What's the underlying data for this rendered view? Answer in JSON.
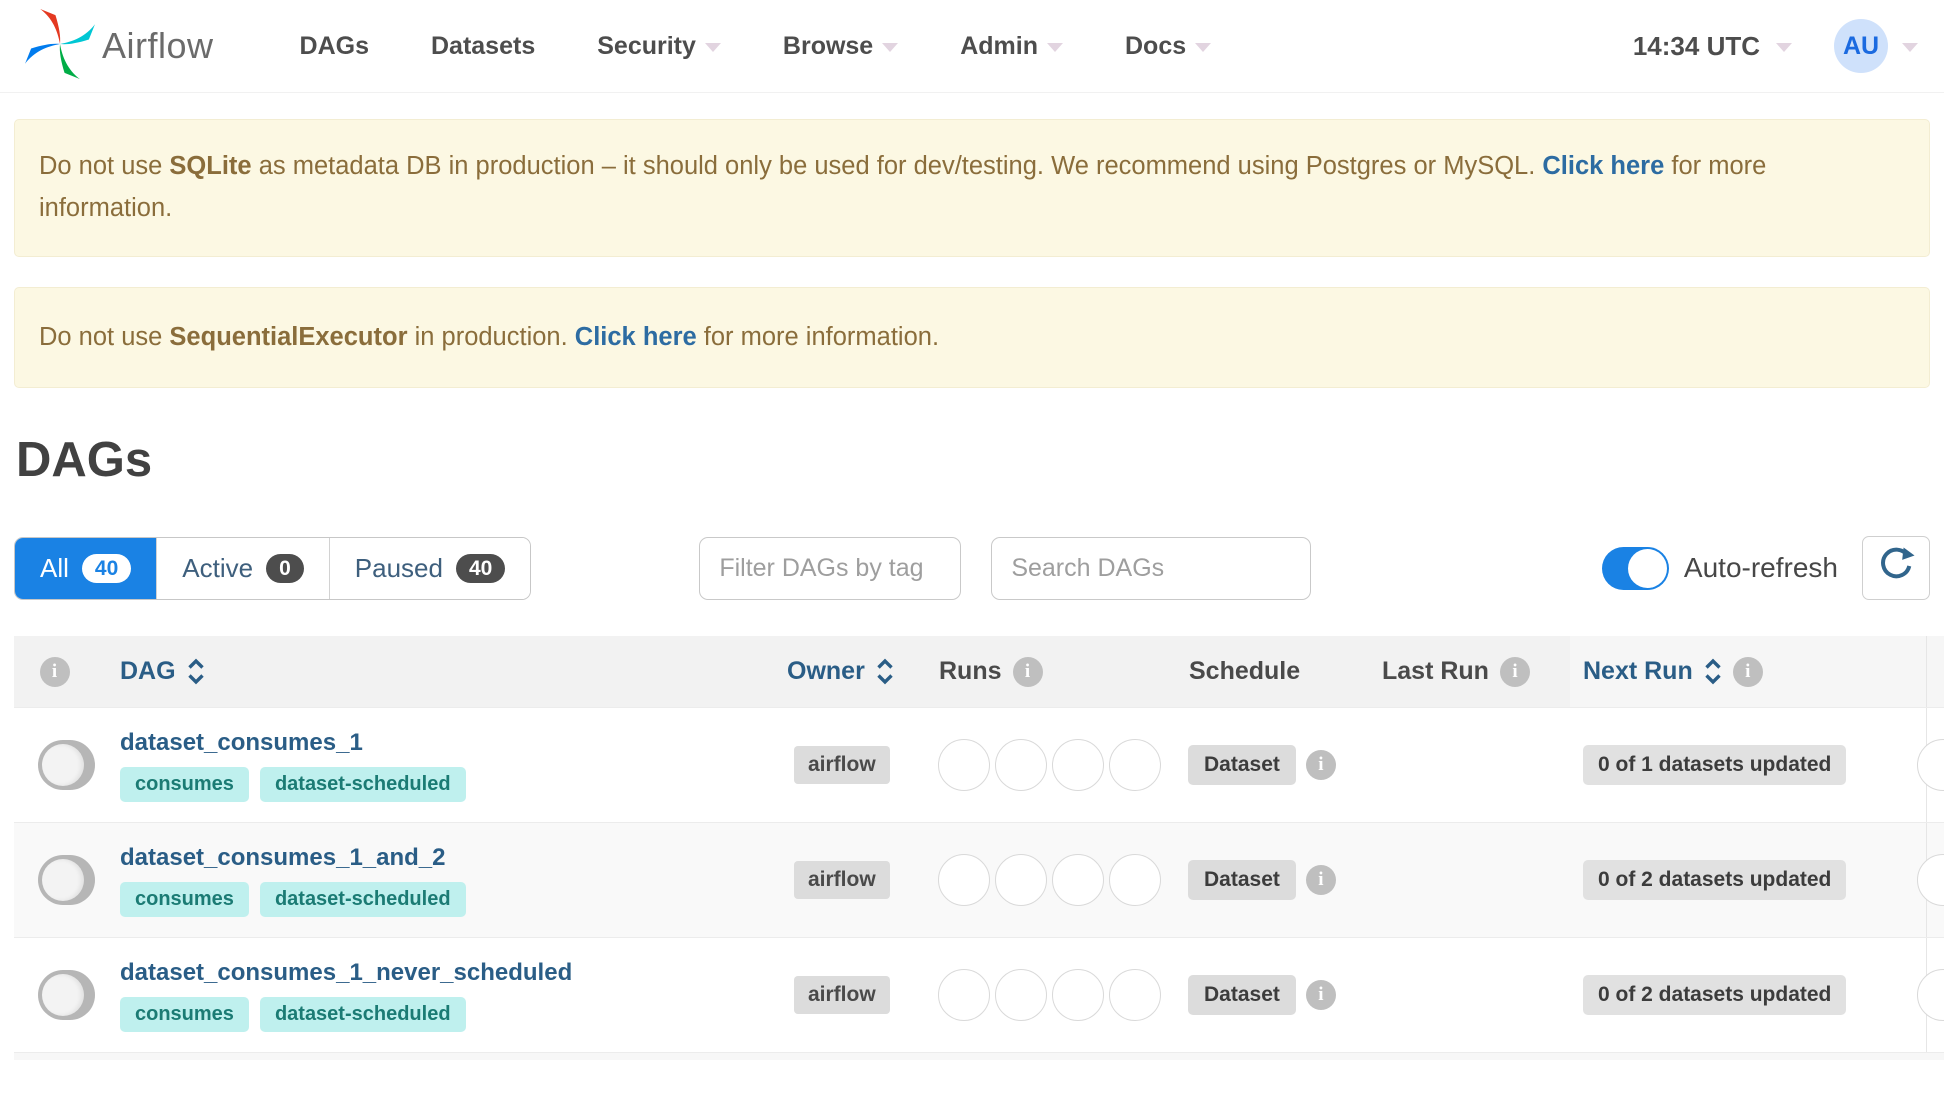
{
  "nav": {
    "brand": "Airflow",
    "items": [
      {
        "label": "DAGs",
        "caret": false
      },
      {
        "label": "Datasets",
        "caret": false
      },
      {
        "label": "Security",
        "caret": true
      },
      {
        "label": "Browse",
        "caret": true
      },
      {
        "label": "Admin",
        "caret": true
      },
      {
        "label": "Docs",
        "caret": true
      }
    ],
    "clock": "14:34 UTC",
    "avatar_initials": "AU"
  },
  "alerts": [
    {
      "prefix": "Do not use ",
      "strong": "SQLite",
      "middle": " as metadata DB in production – it should only be used for dev/testing. We recommend using Postgres or MySQL. ",
      "link": "Click here",
      "suffix": " for more information."
    },
    {
      "prefix": "Do not use ",
      "strong": "SequentialExecutor",
      "middle": " in production. ",
      "link": "Click here",
      "suffix": " for more information."
    }
  ],
  "page": {
    "title": "DAGs"
  },
  "filters": {
    "tabs": [
      {
        "label": "All",
        "count": "40",
        "active": true
      },
      {
        "label": "Active",
        "count": "0",
        "active": false
      },
      {
        "label": "Paused",
        "count": "40",
        "active": false
      }
    ],
    "tag_filter_placeholder": "Filter DAGs by tag",
    "search_placeholder": "Search DAGs",
    "autorefresh_label": "Auto-refresh",
    "autorefresh_on": true
  },
  "table": {
    "columns": {
      "dag": "DAG",
      "owner": "Owner",
      "runs": "Runs",
      "schedule": "Schedule",
      "last_run": "Last Run",
      "next_run": "Next Run"
    },
    "rows": [
      {
        "name": "dataset_consumes_1",
        "tags": [
          "consumes",
          "dataset-scheduled"
        ],
        "owner": "airflow",
        "schedule": "Dataset",
        "last_run": "",
        "next_run": "0 of 1 datasets updated",
        "paused": true
      },
      {
        "name": "dataset_consumes_1_and_2",
        "tags": [
          "consumes",
          "dataset-scheduled"
        ],
        "owner": "airflow",
        "schedule": "Dataset",
        "last_run": "",
        "next_run": "0 of 2 datasets updated",
        "paused": true
      },
      {
        "name": "dataset_consumes_1_never_scheduled",
        "tags": [
          "consumes",
          "dataset-scheduled"
        ],
        "owner": "airflow",
        "schedule": "Dataset",
        "last_run": "",
        "next_run": "0 of 2 datasets updated",
        "paused": true
      }
    ]
  },
  "colors": {
    "accent_blue": "#1a82e4",
    "navy_link": "#2a5d86",
    "alert_bg": "#fcf8e3",
    "alert_text": "#8a6d3b",
    "alert_link": "#2d6ca2",
    "tag_bg": "#bff0ee",
    "tag_text": "#1b7b74",
    "badge_bg": "#dcdcdc",
    "avatar_bg": "#cfe1fb",
    "avatar_text": "#1b6ae0",
    "logo_red": "#e43921",
    "logo_teal": "#00c7d4",
    "logo_green": "#00ad46",
    "logo_blue": "#017cee"
  }
}
